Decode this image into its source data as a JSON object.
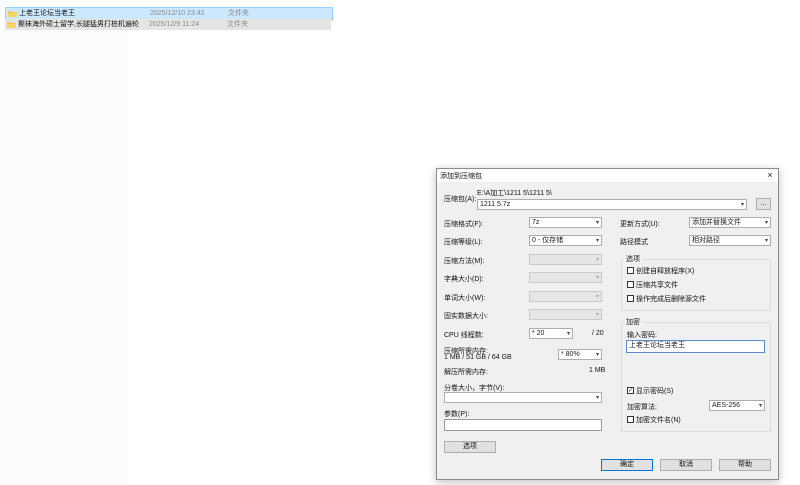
{
  "files": [
    {
      "name": "上老王论坛当老王",
      "date": "2025/12/10 23:42",
      "type": "文件夹",
      "selected": true
    },
    {
      "name": "撕袜海外硕士留学,长腿猛男打桩机遍轮",
      "date": "2025/12/9 11:24",
      "type": "文件夹",
      "selected": false
    }
  ],
  "dialog": {
    "title": "添加到压缩包",
    "close": "×",
    "archive_label": "压缩包(A):",
    "archive_path": "E:\\A加工\\1211 5\\1211 5\\",
    "archive_name": "1211 5.7z",
    "browse": "...",
    "format_label": "压缩格式(F):",
    "format_value": "7z",
    "level_label": "压缩等级(L):",
    "level_value": "0 - 仅存储",
    "method_label": "压缩方法(M):",
    "dict_label": "字典大小(D):",
    "word_label": "单词大小(W):",
    "solid_label": "固实数据大小:",
    "cpu_label": "CPU 线程数:",
    "cpu_value": "* 20",
    "cpu_max": "/ 20",
    "mem_comp_label": "压缩所需内存:",
    "mem_comp_value": "1 MB / 51 GB / 64 GB",
    "mem_pct": "* 80%",
    "mem_decomp_label": "解压所需内存:",
    "mem_decomp_value": "1 MB",
    "split_label": "分卷大小，字节(V):",
    "params_label": "参数(P):",
    "options_btn": "选项",
    "update_label": "更新方式(U):",
    "update_value": "添加并替换文件",
    "path_label": "路径模式",
    "path_value": "相对路径",
    "options_group": "选项",
    "opt_sfx": "创建自释放程序(X)",
    "opt_shared": "压缩共享文件",
    "opt_delete": "操作完成后删除源文件",
    "enc_group": "加密",
    "pwd_label": "输入密码:",
    "pwd_value": "上老王论坛当老王",
    "show_pwd": "显示密码(S)",
    "enc_method_label": "加密算法:",
    "enc_method_value": "AES-256",
    "enc_names": "加密文件名(N)",
    "ok": "确定",
    "cancel": "取消",
    "help": "帮助",
    "check_mark": "✓"
  }
}
